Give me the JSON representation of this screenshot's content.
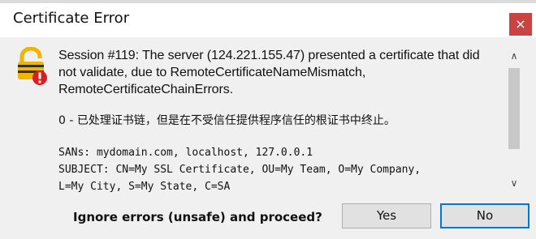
{
  "window": {
    "title": "Certificate Error",
    "close_label": "×"
  },
  "message": {
    "line1": "Session #119: The server (124.221.155.47) presented a certificate that did",
    "line2": "not validate, due to RemoteCertificateNameMismatch,",
    "line3": "RemoteCertificateChainErrors.",
    "line4": "0 - 已处理证书链，但是在不受信任提供程序信任的根证书中终止。",
    "line5": "SANs: mydomain.com, localhost, 127.0.0.1",
    "line6": "SUBJECT: CN=My SSL Certificate, OU=My Team, O=My Company,",
    "line7": "L=My City, S=My State, C=SA"
  },
  "scrollbar": {
    "up_arrow": "∧",
    "down_arrow": "∨"
  },
  "prompt": {
    "text": "Ignore errors (unsafe) and proceed?"
  },
  "buttons": {
    "yes_label": "Yes",
    "no_label": "No"
  },
  "icons": {
    "warning": "warning-lock-icon"
  },
  "colors": {
    "close_button": "#c94343",
    "focus_border": "#0078d7",
    "icon_gold": "#f1b400",
    "icon_red": "#d42020"
  }
}
